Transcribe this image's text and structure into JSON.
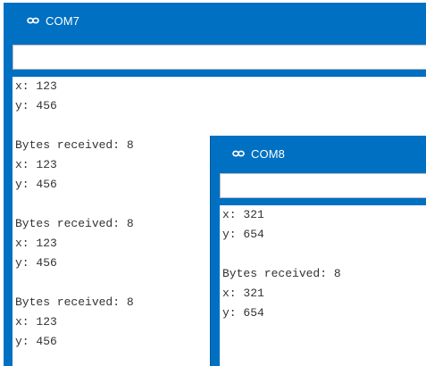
{
  "colors": {
    "titlebar": "#0070c2",
    "title_text": "#ffffff",
    "logo": "#ffffff",
    "monitor_bg": "#ffffff",
    "monitor_text": "#333333"
  },
  "windows": [
    {
      "title": "COM7",
      "icon": "arduino-infinity-logo",
      "input_value": "",
      "lines": [
        "x: 123",
        "y: 456",
        "",
        "Bytes received: 8",
        "x: 123",
        "y: 456",
        "",
        "Bytes received: 8",
        "x: 123",
        "y: 456",
        "",
        "Bytes received: 8",
        "x: 123",
        "y: 456"
      ]
    },
    {
      "title": "COM8",
      "icon": "arduino-infinity-logo",
      "input_value": "",
      "lines": [
        "x: 321",
        "y: 654",
        "",
        "Bytes received: 8",
        "x: 321",
        "y: 654"
      ]
    }
  ]
}
